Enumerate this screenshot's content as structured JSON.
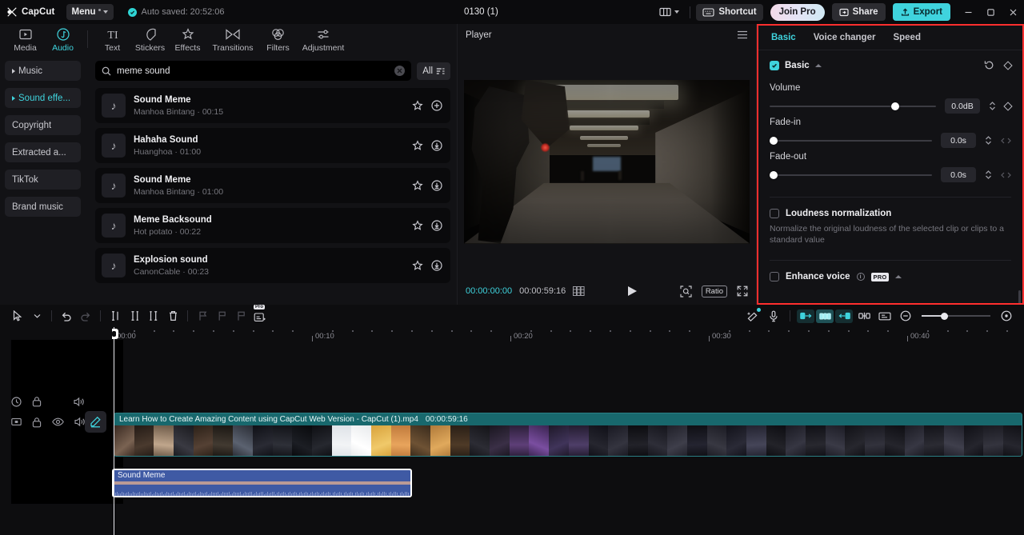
{
  "titlebar": {
    "app_name": "CapCut",
    "menu_label": "Menu",
    "autosave_text": "Auto saved: 20:52:06",
    "project_title": "0130 (1)",
    "shortcut_label": "Shortcut",
    "join_pro_label": "Join Pro",
    "share_label": "Share",
    "export_label": "Export",
    "accent_color": "#3fd3dd",
    "highlight_color": "#ff2e2e"
  },
  "nav_tabs": [
    {
      "label": "Media",
      "icon": "media-icon",
      "active": false
    },
    {
      "label": "Audio",
      "icon": "audio-icon",
      "active": true
    },
    {
      "label": "Text",
      "icon": "text-icon",
      "active": false
    },
    {
      "label": "Stickers",
      "icon": "stickers-icon",
      "active": false
    },
    {
      "label": "Effects",
      "icon": "effects-icon",
      "active": false
    },
    {
      "label": "Transitions",
      "icon": "transitions-icon",
      "active": false
    },
    {
      "label": "Filters",
      "icon": "filters-icon",
      "active": false
    },
    {
      "label": "Adjustment",
      "icon": "adjustment-icon",
      "active": false
    }
  ],
  "categories": [
    {
      "label": "Music",
      "expandable": true,
      "active": false
    },
    {
      "label": "Sound effe...",
      "expandable": true,
      "active": true
    },
    {
      "label": "Copyright",
      "expandable": false,
      "active": false
    },
    {
      "label": "Extracted a...",
      "expandable": false,
      "active": false
    },
    {
      "label": "TikTok",
      "expandable": false,
      "active": false
    },
    {
      "label": "Brand music",
      "expandable": false,
      "active": false
    }
  ],
  "search": {
    "value": "meme sound",
    "placeholder": "Search",
    "filter_label": "All"
  },
  "sound_list": [
    {
      "title": "Sound Meme",
      "author": "Manhoa Bintang",
      "duration": "00:15",
      "action": "add"
    },
    {
      "title": "Hahaha Sound",
      "author": "Huanghoa",
      "duration": "01:00",
      "action": "download"
    },
    {
      "title": "Sound Meme",
      "author": "Manhoa Bintang",
      "duration": "01:00",
      "action": "download"
    },
    {
      "title": "Meme Backsound",
      "author": "Hot potato",
      "duration": "00:22",
      "action": "download"
    },
    {
      "title": "Explosion sound",
      "author": "CanonCable",
      "duration": "00:23",
      "action": "download"
    }
  ],
  "player": {
    "header_title": "Player",
    "current_time": "00:00:00:00",
    "total_time": "00:00:59:16",
    "ratio_label": "Ratio"
  },
  "properties": {
    "tabs": [
      {
        "label": "Basic",
        "active": true
      },
      {
        "label": "Voice changer",
        "active": false
      },
      {
        "label": "Speed",
        "active": false
      }
    ],
    "section_title": "Basic",
    "section_checked": true,
    "controls": [
      {
        "label": "Volume",
        "value": "0.0dB",
        "knob_pct": 73,
        "keyframe": true
      },
      {
        "label": "Fade-in",
        "value": "0.0s",
        "knob_pct": 0,
        "keyframe": false
      },
      {
        "label": "Fade-out",
        "value": "0.0s",
        "knob_pct": 0,
        "keyframe": false
      }
    ],
    "loudness": {
      "title": "Loudness normalization",
      "checked": false,
      "description": "Normalize the original loudness of the selected clip or clips to a standard value"
    },
    "enhance_voice": {
      "title": "Enhance voice",
      "checked": false,
      "badge": "PRO"
    }
  },
  "timeline": {
    "ruler_labels": [
      "00:00",
      "00:10",
      "00:20",
      "00:30",
      "00:40"
    ],
    "playhead_time": "0",
    "video_track": {
      "name": "Learn How to Create Amazing Content using CapCut Web Version - CapCut (1).mp4",
      "duration": "00:00:59:16"
    },
    "audio_track": {
      "name": "Sound Meme"
    },
    "video_controls": [
      "keyframe-icon",
      "lock-icon",
      "eye-icon",
      "speaker-icon"
    ],
    "audio_controls": [
      "mute-toggle-icon",
      "lock-icon",
      "speaker-icon"
    ],
    "toolbar_left": [
      "select-icon",
      "chevron-down-icon",
      "undo-icon",
      "redo-icon",
      "split-icon",
      "trim-left-icon",
      "trim-right-icon",
      "delete-icon",
      "marker-left-icon",
      "flag-icon",
      "marker-right-icon",
      "auto-caption-pro-icon"
    ],
    "toolbar_right": [
      "magic-wand-icon",
      "microphone-icon",
      "clip-start-icon",
      "clip-mid-icon",
      "clip-end-icon",
      "mirror-icon",
      "crop-icon",
      "zoom-out-icon",
      "zoom-in-icon"
    ],
    "zoom_pct": 30
  }
}
